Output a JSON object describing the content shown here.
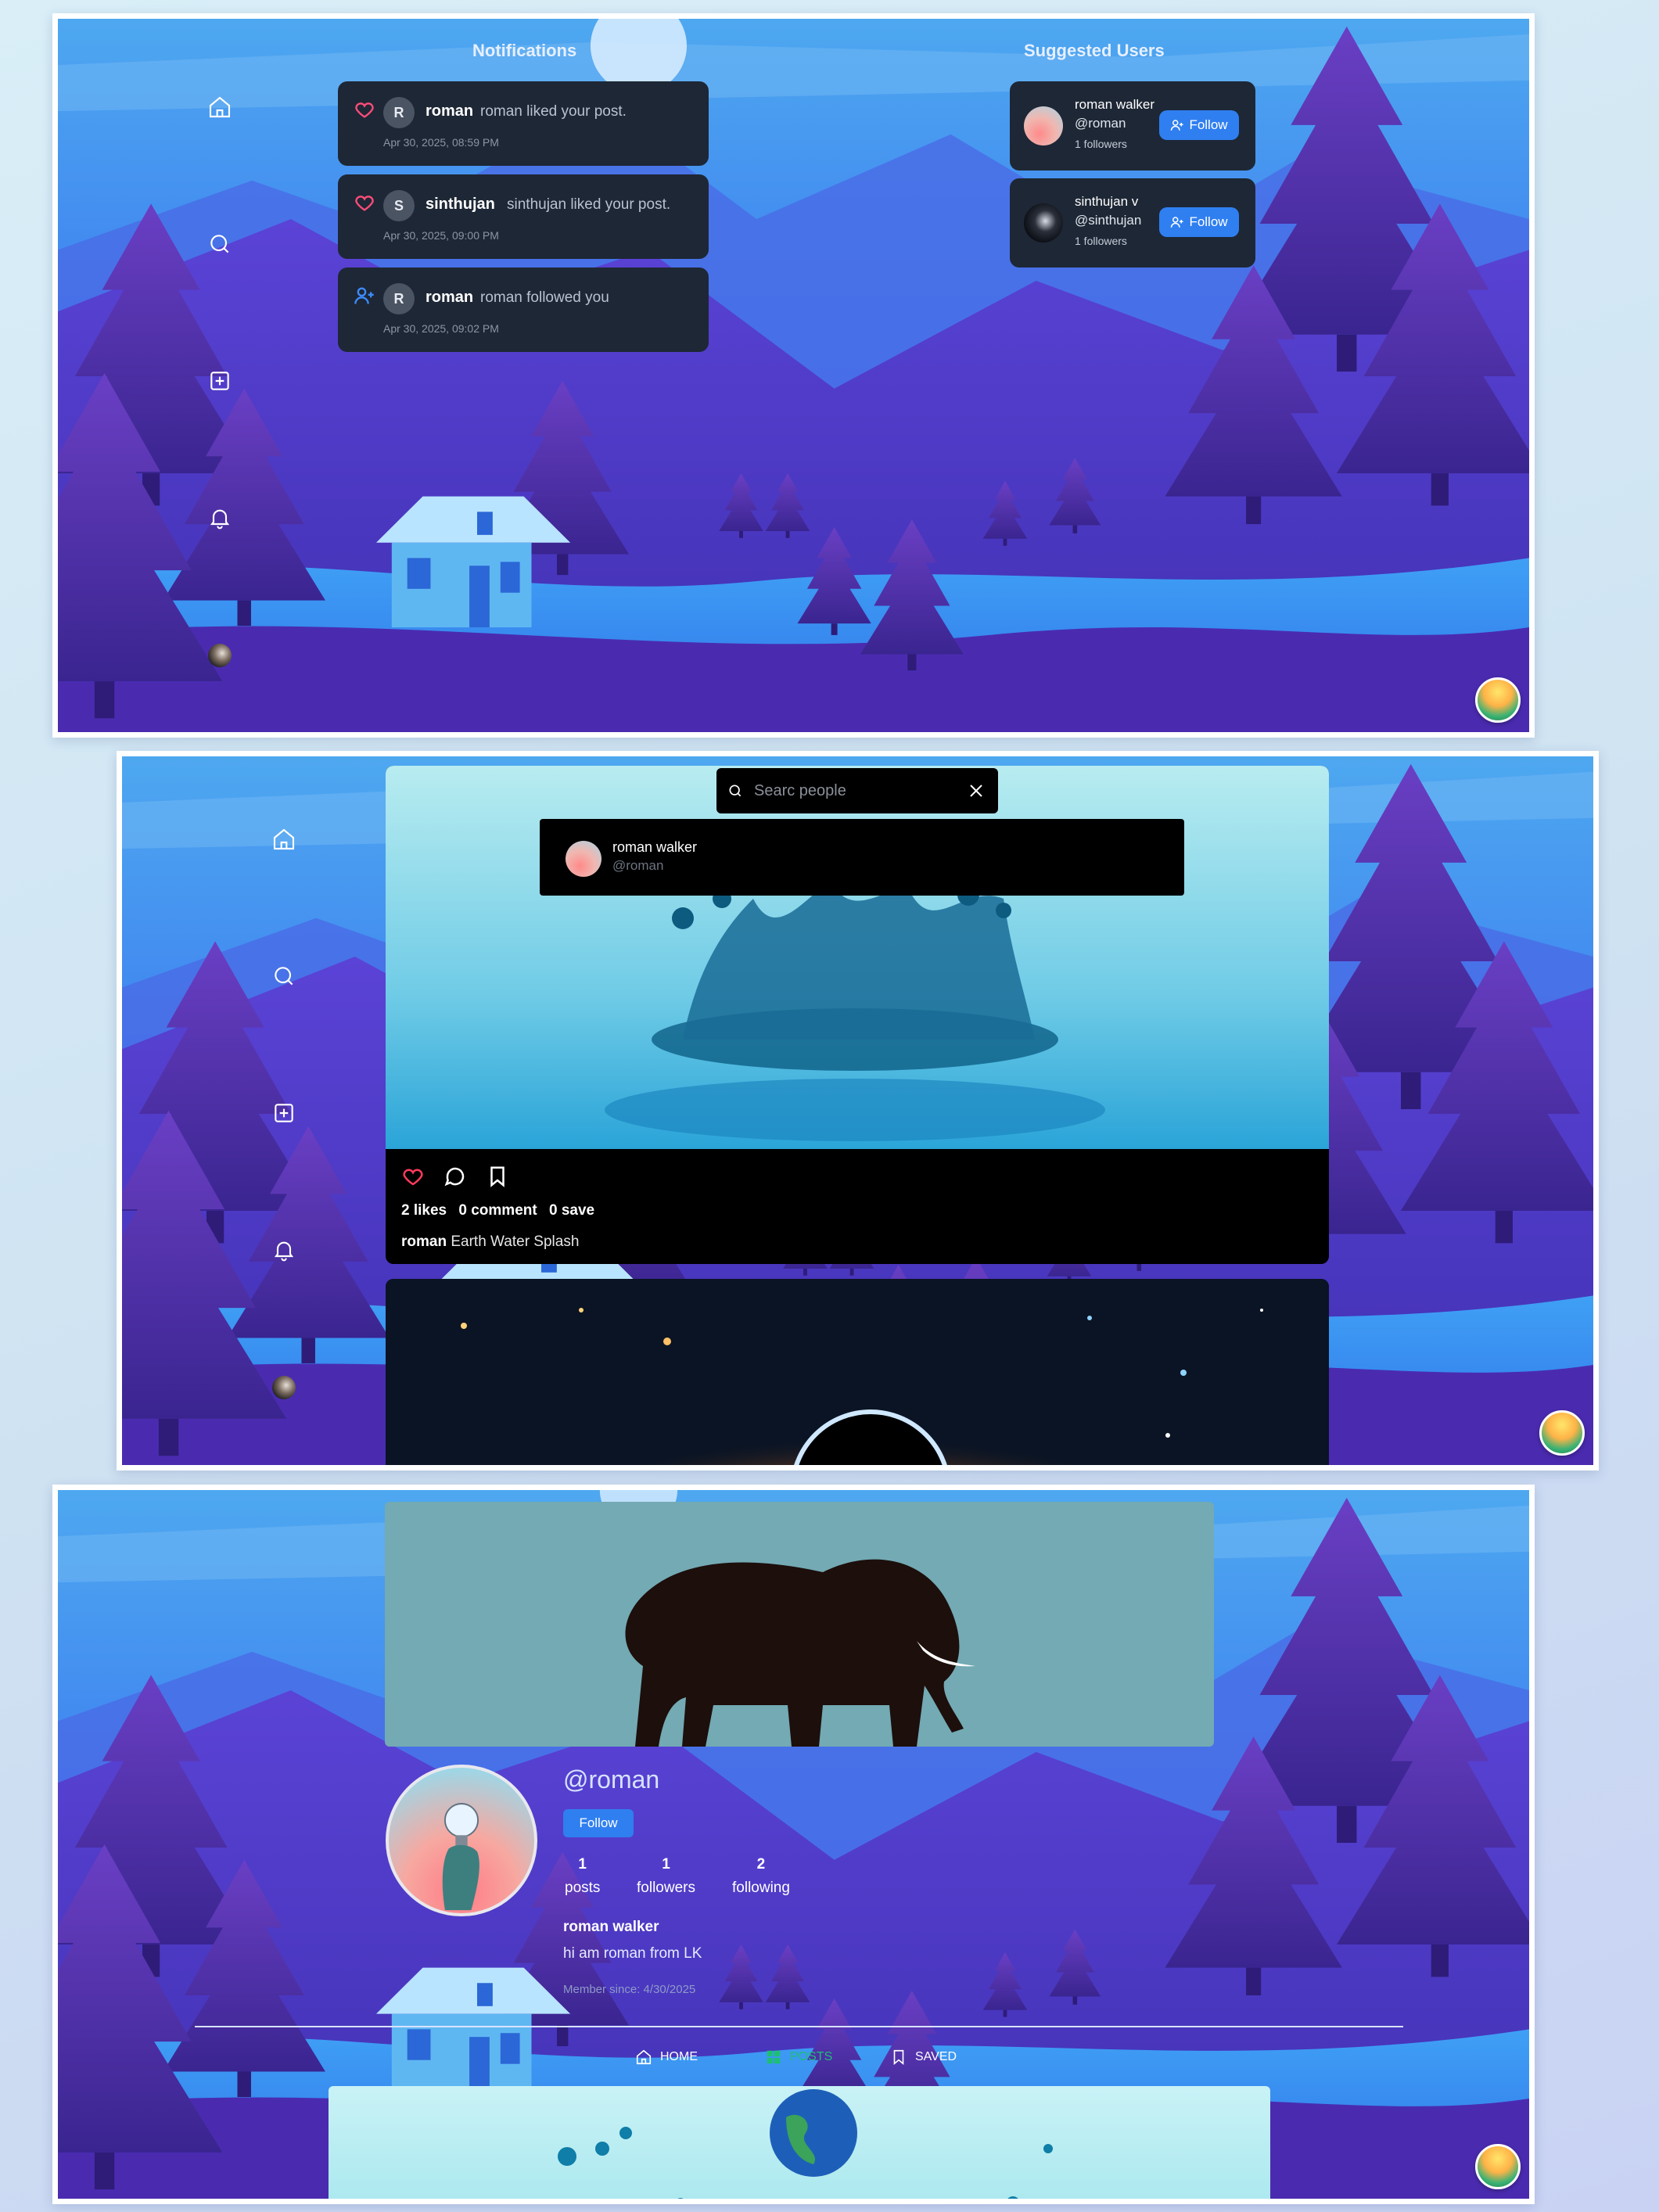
{
  "sidebar": {
    "items": [
      {
        "icon": "home-icon",
        "label": "Home"
      },
      {
        "icon": "search-icon",
        "label": "Search"
      },
      {
        "icon": "create-icon",
        "label": "Create"
      },
      {
        "icon": "bell-icon",
        "label": "Notifications"
      },
      {
        "icon": "avatar",
        "label": "Profile"
      }
    ]
  },
  "notifications": {
    "title": "Notifications",
    "items": [
      {
        "icon": "heart-icon",
        "avatar_letter": "R",
        "user": "roman",
        "text": "roman liked your post.",
        "time": "Apr 30, 2025, 08:59 PM"
      },
      {
        "icon": "heart-icon",
        "avatar_letter": "S",
        "user": "sinthujan",
        "text": "sinthujan liked your post.",
        "time": "Apr 30, 2025, 09:00 PM"
      },
      {
        "icon": "user-plus-icon",
        "avatar_letter": "R",
        "user": "roman",
        "text": "roman followed you",
        "time": "Apr 30, 2025, 09:02 PM"
      }
    ]
  },
  "suggested": {
    "title": "Suggested Users",
    "users": [
      {
        "name": "roman walker",
        "handle": "@roman",
        "followers": "1 followers",
        "button": "Follow"
      },
      {
        "name": "sinthujan v",
        "handle": "@sinthujan",
        "followers": "1 followers",
        "button": "Follow"
      }
    ]
  },
  "search": {
    "placeholder": "Searc people",
    "results": [
      {
        "name": "roman walker",
        "handle": "@roman"
      }
    ]
  },
  "feed": {
    "post": {
      "likes": "2 likes",
      "comments": "0 comment",
      "saves": "0 save",
      "author": "roman",
      "caption": "Earth Water Splash"
    }
  },
  "profile": {
    "handle": "@roman",
    "follow_label": "Follow",
    "stats": [
      {
        "value": "1",
        "label": "posts"
      },
      {
        "value": "1",
        "label": "followers"
      },
      {
        "value": "2",
        "label": "following"
      }
    ],
    "name": "roman walker",
    "bio": "hi am roman from LK",
    "member_since": "Member since: 4/30/2025",
    "tabs": [
      {
        "icon": "home-icon",
        "label": "HOME"
      },
      {
        "icon": "grid-icon",
        "label": "POSTS"
      },
      {
        "icon": "bookmark-icon",
        "label": "SAVED"
      }
    ]
  },
  "colors": {
    "accent": "#2f7ff0",
    "card_bg": "#1e2735",
    "heart": "#ff4d7a",
    "active_tab": "#1dbf73"
  }
}
